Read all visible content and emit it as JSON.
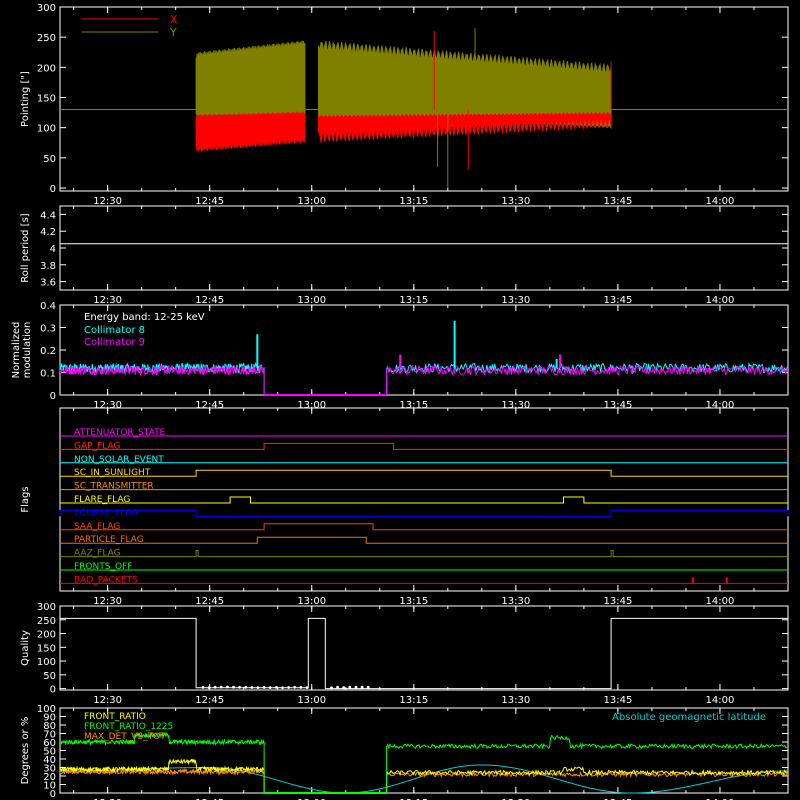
{
  "time_ticks": [
    "12:30",
    "12:45",
    "13:00",
    "13:15",
    "13:30",
    "13:45",
    "14:00"
  ],
  "time_domain": [
    "12:23",
    "14:10"
  ],
  "chart_data": [
    {
      "type": "line",
      "id": "pointing",
      "ylabel": "Pointing [\"]",
      "ylim": [
        -5,
        300
      ],
      "yticks": [
        0,
        50,
        100,
        150,
        200,
        250,
        300
      ],
      "legend": [
        {
          "name": "X",
          "color": "#ff0000"
        },
        {
          "name": "Y",
          "color": "#808000"
        }
      ],
      "reference_line": 130,
      "series": [
        {
          "name": "X",
          "color": "#ff0000",
          "segments": [
            {
              "start": "12:43",
              "end": "12:59",
              "low": [
                60,
                75
              ],
              "high": [
                120,
                125
              ]
            },
            {
              "start": "13:01",
              "end": "13:44",
              "low": [
                75,
                100
              ],
              "high": [
                120,
                125
              ]
            }
          ]
        },
        {
          "name": "Y",
          "color": "#808000",
          "segments": [
            {
              "start": "12:43",
              "end": "12:59",
              "low": [
                120,
                120
              ],
              "high": [
                225,
                245
              ]
            },
            {
              "start": "13:01",
              "end": "13:44",
              "low": [
                115,
                100
              ],
              "high": [
                245,
                205
              ]
            }
          ]
        }
      ],
      "spikes": [
        {
          "t": "13:20",
          "v": 0,
          "color": "#808000"
        },
        {
          "t": "13:18.5",
          "v": 35,
          "color": "#808000"
        },
        {
          "t": "13:23",
          "v": 30,
          "color": "#ff0000"
        },
        {
          "t": "13:18",
          "v": 260,
          "color": "#ff0000"
        },
        {
          "t": "13:24",
          "v": 265,
          "color": "#808000"
        },
        {
          "t": "13:44",
          "v": 210,
          "color": "#ff0000"
        }
      ]
    },
    {
      "type": "line",
      "id": "roll",
      "ylabel": "Roll period [s]",
      "ylim": [
        3.5,
        4.5
      ],
      "yticks": [
        3.6,
        3.8,
        4.0,
        4.2,
        4.4
      ],
      "value": 4.05
    },
    {
      "type": "line",
      "id": "modulation",
      "ylabel_lines": [
        "Normalized",
        "modulation"
      ],
      "ylim": [
        0,
        0.4
      ],
      "yticks": [
        0.0,
        0.1,
        0.2,
        0.3,
        0.4
      ],
      "annotation": "Energy band: 12-25 keV",
      "series": [
        {
          "name": "Collimator 8",
          "color": "#00ffff",
          "segments": [
            {
              "start": "12:23",
              "end": "12:53",
              "level": 0.12
            },
            {
              "start": "13:11",
              "end": "14:10",
              "level": 0.12
            }
          ],
          "zero": {
            "start": "12:53",
            "end": "13:11"
          }
        },
        {
          "name": "Collimator 9",
          "color": "#ff00ff",
          "segments": [
            {
              "start": "12:23",
              "end": "12:53",
              "level": 0.11
            },
            {
              "start": "13:11",
              "end": "14:10",
              "level": 0.11
            }
          ],
          "zero": {
            "start": "12:53",
            "end": "13:11"
          }
        }
      ],
      "peaks": [
        {
          "t": "12:52",
          "v": 0.27,
          "color": "#00ffff"
        },
        {
          "t": "13:13",
          "v": 0.18,
          "color": "#ff00ff"
        },
        {
          "t": "13:21",
          "v": 0.33,
          "color": "#00ffff"
        },
        {
          "t": "13:36.5",
          "v": 0.18,
          "color": "#ff00ff"
        },
        {
          "t": "13:36",
          "v": 0.16,
          "color": "#00ffff"
        }
      ]
    },
    {
      "type": "line",
      "id": "flags",
      "ylabel": "Flags",
      "flags": [
        {
          "name": "ATTENUATOR_STATE",
          "color": "#ff00ff",
          "steps": []
        },
        {
          "name": "GAP_FLAG",
          "color": "#ff2a00",
          "steps": [
            [
              "12:53",
              "13:12"
            ]
          ]
        },
        {
          "name": "NON_SOLAR_EVENT",
          "color": "#00ffff",
          "steps": []
        },
        {
          "name": "SC_IN_SUNLIGHT",
          "color": "#ffd700",
          "steps": [
            [
              "12:43",
              "13:44"
            ]
          ]
        },
        {
          "name": "SC_TRANSMITTER",
          "color": "#ff8c00",
          "steps": []
        },
        {
          "name": "FLARE_FLAG",
          "color": "#ffff00",
          "steps": [
            [
              "12:48",
              "12:51"
            ],
            [
              "13:37",
              "13:40"
            ]
          ]
        },
        {
          "name": "ECLIPSE_FLAG",
          "color": "#0000ff",
          "steps": [
            [
              "12:23",
              "12:43"
            ],
            [
              "13:44",
              "14:10"
            ]
          ]
        },
        {
          "name": "SAA_FLAG",
          "color": "#ff4000",
          "steps": [
            [
              "12:53",
              "13:09"
            ]
          ]
        },
        {
          "name": "PARTICLE_FLAG",
          "color": "#ff6a00",
          "steps": [
            [
              "12:52",
              "13:08"
            ]
          ]
        },
        {
          "name": "AAZ_FLAG",
          "color": "#808000",
          "steps": [
            [
              "12:43",
              "12:43.3"
            ],
            [
              "13:44",
              "13:44.3"
            ]
          ]
        },
        {
          "name": "FRONTS_OFF",
          "color": "#00ff00",
          "steps": []
        },
        {
          "name": "BAD_PACKETS",
          "color": "#ff0000",
          "steps": [],
          "ticks": [
            "13:56",
            "14:01"
          ]
        }
      ]
    },
    {
      "type": "line",
      "id": "quality",
      "ylabel": "Quality",
      "ylim": [
        -5,
        300
      ],
      "yticks": [
        0,
        50,
        100,
        150,
        200,
        250,
        300
      ],
      "levels": [
        {
          "start": "12:23",
          "end": "12:43",
          "v": 255
        },
        {
          "start": "12:43",
          "end": "12:59.5",
          "v": 3
        },
        {
          "start": "12:59.5",
          "end": "13:02",
          "v": 255
        },
        {
          "start": "13:02",
          "end": "13:44",
          "v": 0
        },
        {
          "start": "13:44",
          "end": "14:10",
          "v": 255
        }
      ]
    },
    {
      "type": "line",
      "id": "ratios",
      "ylabel": "Degrees or %",
      "ylim": [
        0,
        100
      ],
      "yticks": [
        0,
        10,
        20,
        30,
        40,
        50,
        60,
        70,
        80,
        90,
        100
      ],
      "annotation": "Absolute geomagnetic latitude",
      "series": [
        {
          "name": "FRONT_RATIO",
          "color": "#ffff00",
          "segments": [
            {
              "start": "12:23",
              "end": "12:53",
              "level": 28
            },
            {
              "start": "13:11",
              "end": "14:10",
              "level": 24
            }
          ],
          "bumps": [
            {
              "start": "12:39",
              "end": "12:43",
              "v": 37
            },
            {
              "start": "13:37",
              "end": "13:40",
              "v": 28
            }
          ]
        },
        {
          "name": "FRONT_RATIO_1225",
          "color": "#00ff00",
          "segments": [
            {
              "start": "12:23",
              "end": "12:53",
              "level": 60
            },
            {
              "start": "13:11",
              "end": "14:10",
              "level": 55
            }
          ],
          "bumps": [
            {
              "start": "12:34",
              "end": "12:39",
              "v": 68
            },
            {
              "start": "13:35",
              "end": "13:38",
              "v": 65
            }
          ]
        },
        {
          "name": "MAX_DET_VS_TOT",
          "color": "#ff8c00",
          "segments": [
            {
              "start": "12:23",
              "end": "12:53",
              "level": 25
            },
            {
              "start": "13:11",
              "end": "14:10",
              "level": 22
            }
          ],
          "bumps": []
        },
        {
          "name": "Absolute geomagnetic latitude",
          "color": "#00d0d0",
          "curve": [
            [
              "12:23",
              26
            ],
            [
              "12:45",
              30
            ],
            [
              "13:05",
              0
            ],
            [
              "13:25",
              33
            ],
            [
              "13:47",
              0
            ],
            [
              "14:10",
              26
            ]
          ]
        }
      ]
    }
  ]
}
